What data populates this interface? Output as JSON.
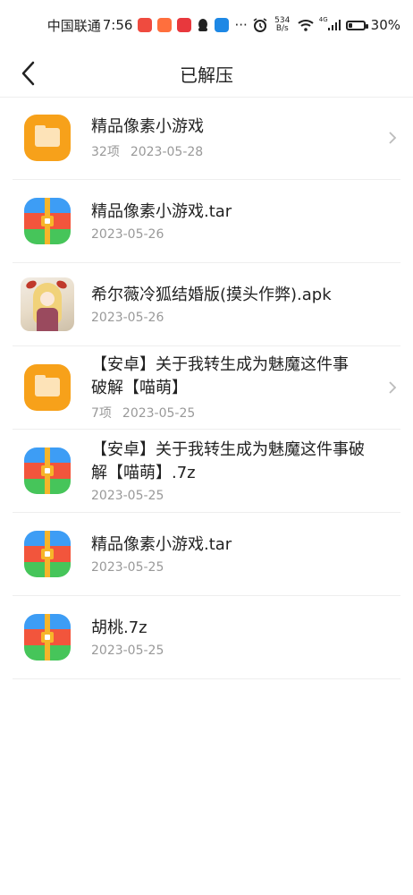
{
  "status_bar": {
    "carrier": "中国联通",
    "time": "7:56",
    "more": "···",
    "net_speed_value": "534",
    "net_speed_unit": "B/s",
    "signal_label": "4G",
    "battery_percent": "30%",
    "battery_level": 0.3
  },
  "header": {
    "title": "已解压"
  },
  "items": [
    {
      "name": "精品像素小游戏",
      "count": "32项",
      "date": "2023-05-28"
    },
    {
      "name": "精品像素小游戏.tar",
      "date": "2023-05-26"
    },
    {
      "name": "希尔薇冷狐结婚版(摸头作弊).apk",
      "date": "2023-05-26"
    },
    {
      "name": "【安卓】关于我转生成为魅魔这件事破解【喵萌】",
      "count": "7项",
      "date": "2023-05-25"
    },
    {
      "name": "【安卓】关于我转生成为魅魔这件事破解【喵萌】.7z",
      "date": "2023-05-25"
    },
    {
      "name": "精品像素小游戏.tar",
      "date": "2023-05-25"
    },
    {
      "name": "胡桃.7z",
      "date": "2023-05-25"
    }
  ],
  "colors": {
    "folder": "#f7a11a",
    "archive_blue": "#3d9df5",
    "archive_red": "#f2553c",
    "archive_green": "#46c55a",
    "zip": "#f6b52a"
  }
}
